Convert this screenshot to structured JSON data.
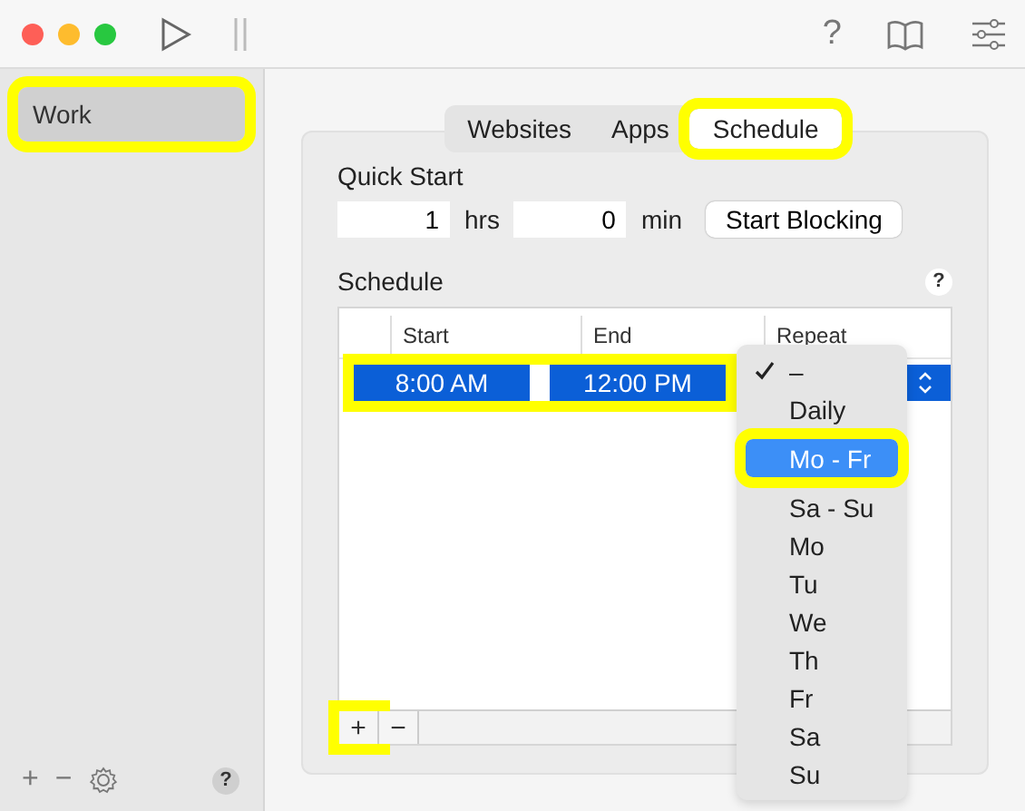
{
  "toolbar": {
    "help": "?"
  },
  "sidebar": {
    "items": [
      {
        "label": "Work",
        "selected": true,
        "highlighted": true
      }
    ],
    "footer": {
      "add": "+",
      "remove": "−",
      "help": "?"
    }
  },
  "tabs": [
    {
      "label": "Websites",
      "selected": false,
      "highlighted": false
    },
    {
      "label": "Apps",
      "selected": false,
      "highlighted": false
    },
    {
      "label": "Schedule",
      "selected": true,
      "highlighted": true
    }
  ],
  "quick_start": {
    "title": "Quick Start",
    "hours": "1",
    "hours_unit": "hrs",
    "minutes": "0",
    "minutes_unit": "min",
    "button": "Start Blocking"
  },
  "schedule": {
    "title": "Schedule",
    "help": "?",
    "columns": [
      {
        "label": "Start"
      },
      {
        "label": "End"
      },
      {
        "label": "Repeat"
      }
    ],
    "rows": [
      {
        "start": "8:00 AM",
        "end": "12:00 PM",
        "selected": true,
        "highlighted": true
      }
    ],
    "add_button": {
      "label": "+",
      "highlighted": true
    },
    "remove_button": {
      "label": "−",
      "highlighted": false
    },
    "repeat_menu": [
      {
        "label": "–",
        "checked": true,
        "selected": false,
        "highlighted": false
      },
      {
        "label": "Daily",
        "checked": false,
        "selected": false,
        "highlighted": false
      },
      {
        "label": "Mo - Fr",
        "checked": false,
        "selected": true,
        "highlighted": true
      },
      {
        "label": "Sa - Su",
        "checked": false,
        "selected": false,
        "highlighted": false
      },
      {
        "label": "Mo",
        "checked": false,
        "selected": false,
        "highlighted": false
      },
      {
        "label": "Tu",
        "checked": false,
        "selected": false,
        "highlighted": false
      },
      {
        "label": "We",
        "checked": false,
        "selected": false,
        "highlighted": false
      },
      {
        "label": "Th",
        "checked": false,
        "selected": false,
        "highlighted": false
      },
      {
        "label": "Fr",
        "checked": false,
        "selected": false,
        "highlighted": false
      },
      {
        "label": "Sa",
        "checked": false,
        "selected": false,
        "highlighted": false
      },
      {
        "label": "Su",
        "checked": false,
        "selected": false,
        "highlighted": false
      }
    ]
  }
}
